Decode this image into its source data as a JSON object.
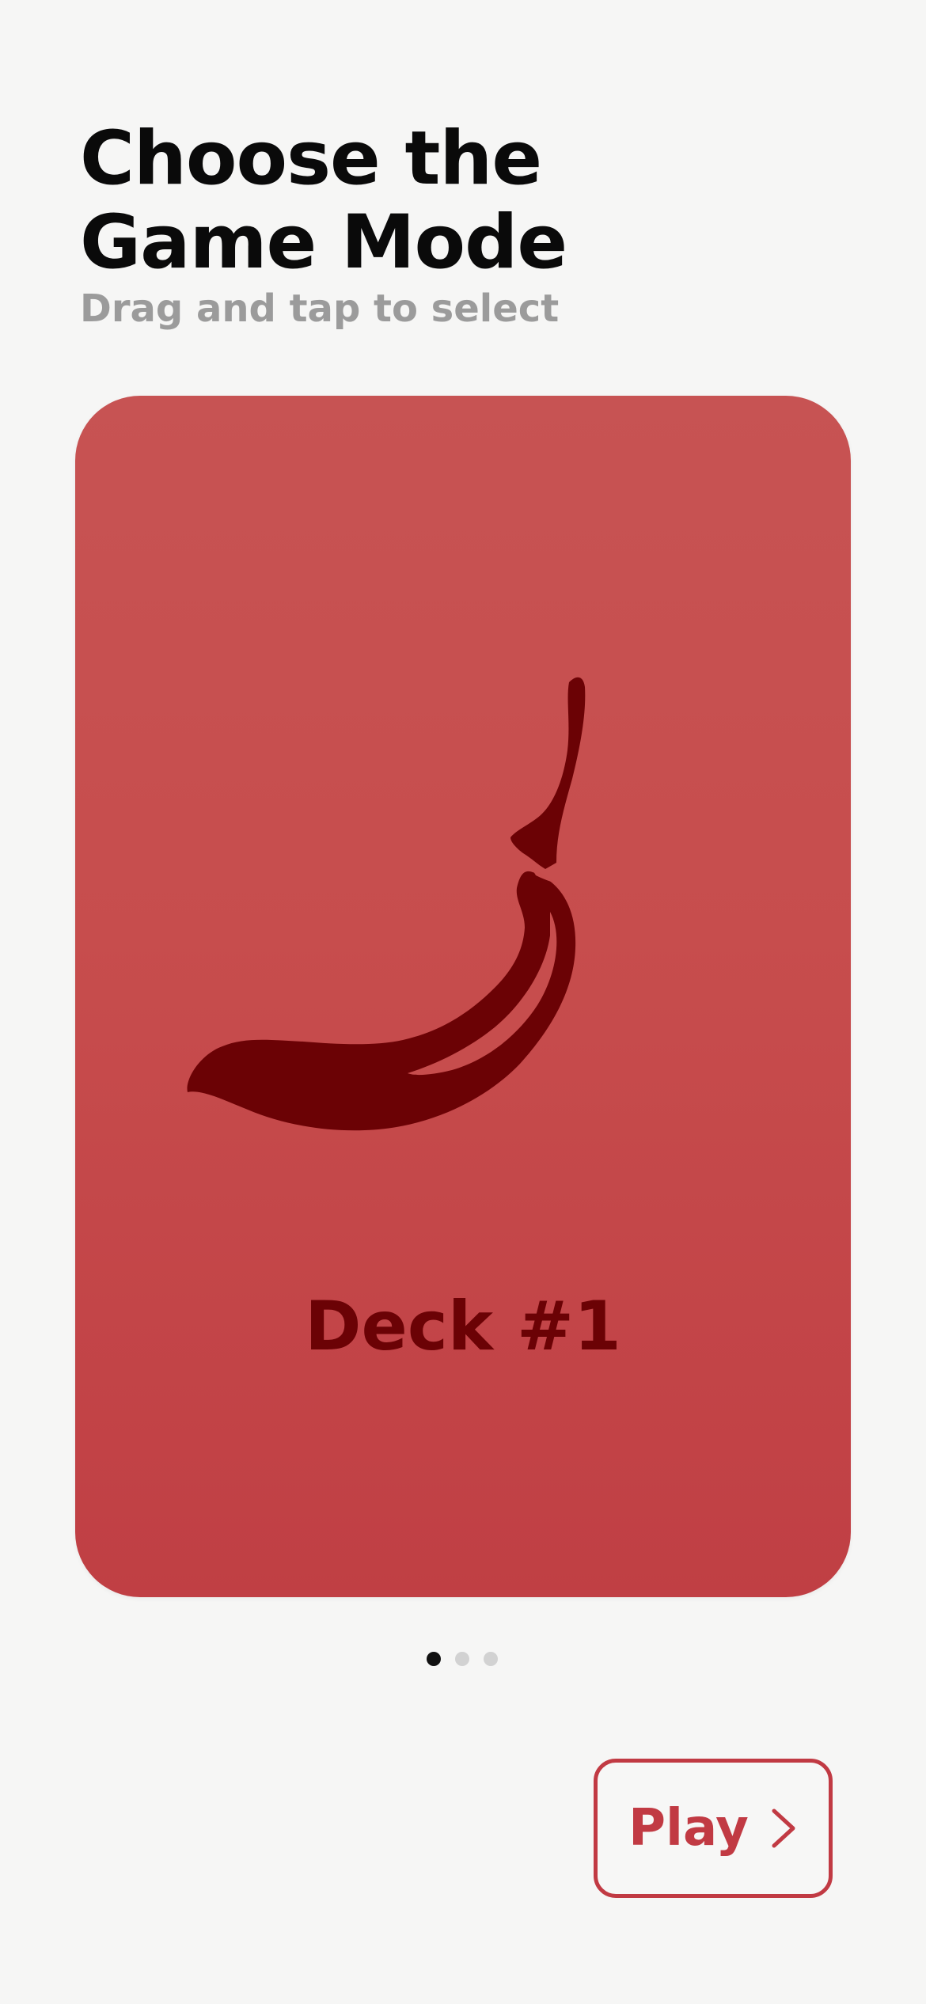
{
  "header": {
    "title_line1": "Choose the",
    "title_line2": "Game Mode",
    "subtitle": "Drag and tap to select"
  },
  "deck": {
    "label": "Deck #1",
    "icon": "chili-pepper-icon",
    "card_color": "#c74d4d",
    "icon_color": "#6b0205"
  },
  "pager": {
    "count": 3,
    "active_index": 0
  },
  "play_button": {
    "label": "Play",
    "icon": "chevron-right-icon",
    "accent_color": "#c13a43"
  }
}
